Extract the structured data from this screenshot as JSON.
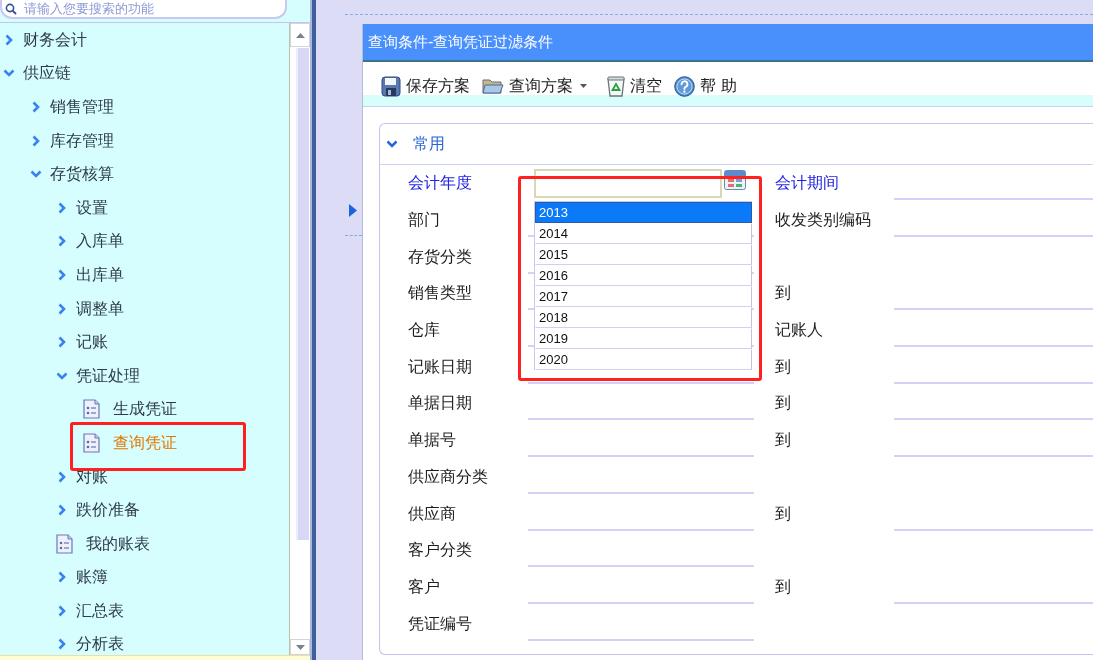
{
  "sidebar": {
    "search": {
      "placeholder": "请输入您要搜索的功能"
    },
    "tree": [
      {
        "label": "财务会计",
        "kind": "folder",
        "expanded": false,
        "selected": false,
        "highlighted": false
      },
      {
        "label": "供应链",
        "kind": "folder",
        "expanded": true,
        "selected": false,
        "highlighted": false,
        "children": [
          {
            "label": "销售管理",
            "kind": "folder",
            "expanded": false,
            "selected": false,
            "highlighted": false
          },
          {
            "label": "库存管理",
            "kind": "folder",
            "expanded": false,
            "selected": false,
            "highlighted": false
          },
          {
            "label": "存货核算",
            "kind": "folder",
            "expanded": true,
            "selected": false,
            "highlighted": false,
            "children": [
              {
                "label": "设置",
                "kind": "folder",
                "expanded": false,
                "selected": false,
                "highlighted": false
              },
              {
                "label": "入库单",
                "kind": "folder",
                "expanded": false,
                "selected": false,
                "highlighted": false
              },
              {
                "label": "出库单",
                "kind": "folder",
                "expanded": false,
                "selected": false,
                "highlighted": false
              },
              {
                "label": "调整单",
                "kind": "folder",
                "expanded": false,
                "selected": false,
                "highlighted": false
              },
              {
                "label": "记账",
                "kind": "folder",
                "expanded": false,
                "selected": false,
                "highlighted": false
              },
              {
                "label": "凭证处理",
                "kind": "folder",
                "expanded": true,
                "selected": false,
                "highlighted": false,
                "children": [
                  {
                    "label": "生成凭证",
                    "kind": "page",
                    "selected": false,
                    "highlighted": false
                  },
                  {
                    "label": "查询凭证",
                    "kind": "page",
                    "selected": true,
                    "highlighted": true
                  }
                ]
              },
              {
                "label": "对账",
                "kind": "folder",
                "expanded": false,
                "selected": false,
                "highlighted": false
              },
              {
                "label": "跌价准备",
                "kind": "folder",
                "expanded": false,
                "selected": false,
                "highlighted": false
              },
              {
                "label": "我的账表",
                "kind": "page",
                "selected": false,
                "highlighted": false
              },
              {
                "label": "账簿",
                "kind": "folder",
                "expanded": false,
                "selected": false,
                "highlighted": false
              },
              {
                "label": "汇总表",
                "kind": "folder",
                "expanded": false,
                "selected": false,
                "highlighted": false
              },
              {
                "label": "分析表",
                "kind": "folder",
                "expanded": false,
                "selected": false,
                "highlighted": false
              }
            ]
          }
        ]
      }
    ]
  },
  "dialog": {
    "title": "查询条件-查询凭证过滤条件",
    "toolbar": [
      {
        "label": "保存方案",
        "has_menu": false
      },
      {
        "label": "查询方案",
        "has_menu": true
      },
      {
        "label": "清空",
        "has_menu": false
      },
      {
        "label": "帮 助",
        "has_menu": false
      }
    ],
    "section": {
      "title": "常用",
      "expanded": true
    },
    "rows": [
      {
        "left": {
          "label": "会计年度",
          "required": true,
          "kind": "picker",
          "dropdown": {
            "highlighted": true,
            "options": [
              {
                "label": "2013",
                "selected": true
              },
              {
                "label": "2014",
                "selected": false
              },
              {
                "label": "2015",
                "selected": false
              },
              {
                "label": "2016",
                "selected": false
              },
              {
                "label": "2017",
                "selected": false
              },
              {
                "label": "2018",
                "selected": false
              },
              {
                "label": "2019",
                "selected": false
              },
              {
                "label": "2020",
                "selected": false
              }
            ]
          }
        },
        "right": {
          "label": "会计期间",
          "required": true
        }
      },
      {
        "left": {
          "label": "部门",
          "required": false,
          "kind": "text"
        },
        "right": {
          "label": "收发类别编码",
          "required": false
        }
      },
      {
        "left": {
          "label": "存货分类",
          "required": false,
          "kind": "text"
        }
      },
      {
        "left": {
          "label": "销售类型",
          "required": false,
          "kind": "text"
        },
        "right": {
          "label": "到",
          "required": false
        }
      },
      {
        "left": {
          "label": "仓库",
          "required": false,
          "kind": "text"
        },
        "right": {
          "label": "记账人",
          "required": false
        }
      },
      {
        "left": {
          "label": "记账日期",
          "required": false,
          "kind": "text"
        },
        "right": {
          "label": "到",
          "required": false
        }
      },
      {
        "left": {
          "label": "单据日期",
          "required": false,
          "kind": "text"
        },
        "right": {
          "label": "到",
          "required": false
        }
      },
      {
        "left": {
          "label": "单据号",
          "required": false,
          "kind": "text"
        },
        "right": {
          "label": "到",
          "required": false
        }
      },
      {
        "left": {
          "label": "供应商分类",
          "required": false,
          "kind": "text"
        }
      },
      {
        "left": {
          "label": "供应商",
          "required": false,
          "kind": "text"
        },
        "right": {
          "label": "到",
          "required": false
        }
      },
      {
        "left": {
          "label": "客户分类",
          "required": false,
          "kind": "text"
        }
      },
      {
        "left": {
          "label": "客户",
          "required": false,
          "kind": "text"
        },
        "right": {
          "label": "到",
          "required": false
        }
      },
      {
        "left": {
          "label": "凭证编号",
          "required": false,
          "kind": "text"
        }
      }
    ]
  }
}
